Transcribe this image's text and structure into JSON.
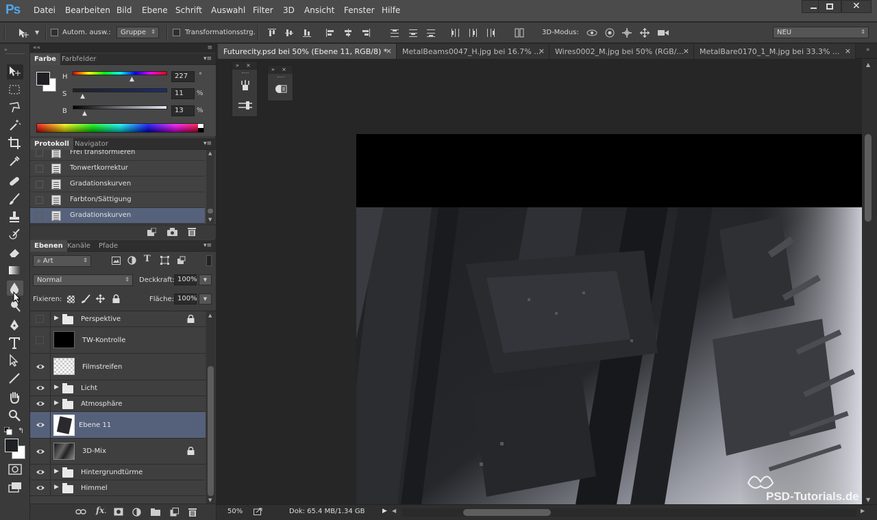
{
  "app": {
    "logo": "Ps",
    "menu": [
      "Datei",
      "Bearbeiten",
      "Bild",
      "Ebene",
      "Schrift",
      "Auswahl",
      "Filter",
      "3D",
      "Ansicht",
      "Fenster",
      "Hilfe"
    ],
    "window_controls": [
      "minimize",
      "maximize",
      "close"
    ]
  },
  "options_bar": {
    "auto_select_label": "Autom. ausw.:",
    "auto_select_value": "Gruppe",
    "transform_label": "Transformationsstrg.",
    "mode_3d_label": "3D-Modus:",
    "workspace": "NEU"
  },
  "color_panel": {
    "tabs": [
      "Farbe",
      "Farbfelder"
    ],
    "sliders": [
      {
        "label": "H",
        "value": "227",
        "unit": "°"
      },
      {
        "label": "S",
        "value": "11",
        "unit": "%"
      },
      {
        "label": "B",
        "value": "13",
        "unit": "%"
      }
    ],
    "slider_positions": [
      0.63,
      0.11,
      0.13
    ]
  },
  "history_panel": {
    "tabs": [
      "Protokoll",
      "Navigator"
    ],
    "items": [
      {
        "label": "Frei transformieren",
        "selected": false
      },
      {
        "label": "Tonwertkorrektur",
        "selected": false
      },
      {
        "label": "Gradationskurven",
        "selected": false
      },
      {
        "label": "Farbton/Sättigung",
        "selected": false
      },
      {
        "label": "Gradationskurven",
        "selected": true
      }
    ]
  },
  "layers_panel": {
    "tabs": [
      "Ebenen",
      "Kanäle",
      "Pfade"
    ],
    "filter_kind": "Art",
    "blend_mode": "Normal",
    "opacity_label": "Deckkraft:",
    "opacity": "100%",
    "lock_label": "Fixieren:",
    "fill_label": "Fläche:",
    "fill": "100%",
    "layers": [
      {
        "name": "Perspektive",
        "type": "group",
        "visible": false,
        "locked": true,
        "selected": false
      },
      {
        "name": "TW-Kontrolle",
        "type": "layer",
        "visible": false,
        "locked": false,
        "selected": false,
        "thumb": "black"
      },
      {
        "name": "Filmstreifen",
        "type": "layer",
        "visible": true,
        "locked": false,
        "selected": false,
        "thumb": "transparent"
      },
      {
        "name": "Licht",
        "type": "group",
        "visible": true,
        "locked": false,
        "selected": false
      },
      {
        "name": "Atmosphäre",
        "type": "group",
        "visible": true,
        "locked": false,
        "selected": false
      },
      {
        "name": "Ebene 11",
        "type": "layer",
        "visible": true,
        "locked": false,
        "selected": true,
        "thumb": "image"
      },
      {
        "name": "3D-Mix",
        "type": "layer",
        "visible": true,
        "locked": true,
        "selected": false,
        "thumb": "image"
      },
      {
        "name": "Hintergrundtürme",
        "type": "group",
        "visible": true,
        "locked": false,
        "selected": false
      },
      {
        "name": "Himmel",
        "type": "group",
        "visible": true,
        "locked": false,
        "selected": false
      }
    ]
  },
  "documents": {
    "tabs": [
      {
        "label": "Futurecity.psd bei 50% (Ebene 11, RGB/8) *",
        "active": true
      },
      {
        "label": "MetalBeams0047_H.jpg bei 16.7% ...",
        "active": false
      },
      {
        "label": "Wires0002_M.jpg bei 50% (RGB/...",
        "active": false
      },
      {
        "label": "MetalBare0170_1_M.jpg bei 33.3% ...",
        "active": false
      }
    ]
  },
  "status": {
    "zoom": "50%",
    "doc_size": "Dok: 65.4 MB/1.34 GB"
  },
  "watermark": "PSD-Tutorials.de",
  "colors": {
    "ps_blue": "#4fa7ee",
    "selection": "#55607a",
    "panel": "#3c3c3c",
    "canvas_bg": "#262626"
  }
}
